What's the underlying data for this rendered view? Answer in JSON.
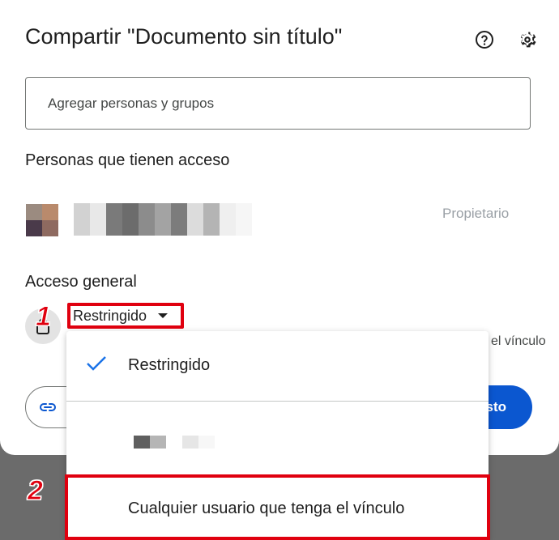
{
  "dialog": {
    "title": "Compartir \"Documento sin título\"",
    "help_icon": "help-circle-icon",
    "settings_icon": "gear-icon"
  },
  "search": {
    "placeholder": "Agregar personas y grupos",
    "value": ""
  },
  "people": {
    "heading": "Personas que tienen acceso",
    "owner": {
      "name": "",
      "role": "Propietario"
    }
  },
  "general_access": {
    "heading": "Acceso general",
    "selected": "Restringido",
    "description_tail": "el vínculo",
    "copy_link_icon": "link-icon",
    "done_label": "Listo",
    "done_visible_fragment": "sto"
  },
  "dropdown": {
    "options": [
      {
        "label": "Restringido",
        "selected": true
      },
      {
        "label": "",
        "selected": false
      },
      {
        "label": "Cualquier usuario que tenga el vínculo",
        "selected": false
      }
    ]
  },
  "annotations": {
    "badge_1": "1",
    "badge_2": "2"
  },
  "colors": {
    "accent": "#0b57d0",
    "highlight": "#e0000f",
    "check": "#1a73e8",
    "overlay": "#6b6b6b"
  }
}
